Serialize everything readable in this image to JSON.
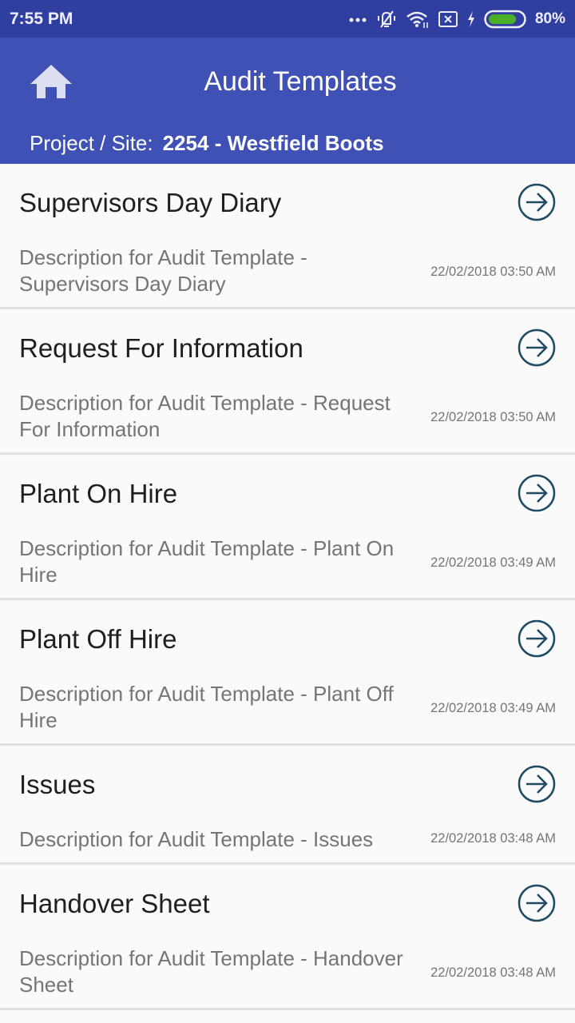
{
  "status_bar": {
    "time": "7:55 PM",
    "icons": [
      "more-dots-icon",
      "vibrate-off-icon",
      "wifi-icon",
      "sim-none-icon",
      "charging-bolt-icon",
      "battery-icon"
    ],
    "battery_percent": "80%",
    "battery_level": 0.8,
    "battery_color": "#4caf2a"
  },
  "header": {
    "home_icon": "home-icon",
    "title": "Audit Templates",
    "project_label": "Project / Site:",
    "project_value": "2254 - Westfield Boots",
    "bar_color": "#3f51b5",
    "status_color": "#303f9f"
  },
  "templates": [
    {
      "title": "Supervisors Day Diary",
      "description": "Description for Audit Template - Supervisors Day Diary",
      "date": "22/02/2018 03:50 AM"
    },
    {
      "title": "Request For Information",
      "description": "Description for Audit Template - Request For Information",
      "date": "22/02/2018 03:50 AM"
    },
    {
      "title": "Plant On Hire",
      "description": "Description for Audit Template - Plant On Hire",
      "date": "22/02/2018 03:49 AM"
    },
    {
      "title": "Plant Off Hire",
      "description": "Description for Audit Template - Plant Off Hire",
      "date": "22/02/2018 03:49 AM"
    },
    {
      "title": "Issues",
      "description": "Description for Audit Template - Issues",
      "date": "22/02/2018 03:48 AM"
    },
    {
      "title": "Handover Sheet",
      "description": "Description for Audit Template - Handover Sheet",
      "date": "22/02/2018 03:48 AM"
    }
  ]
}
